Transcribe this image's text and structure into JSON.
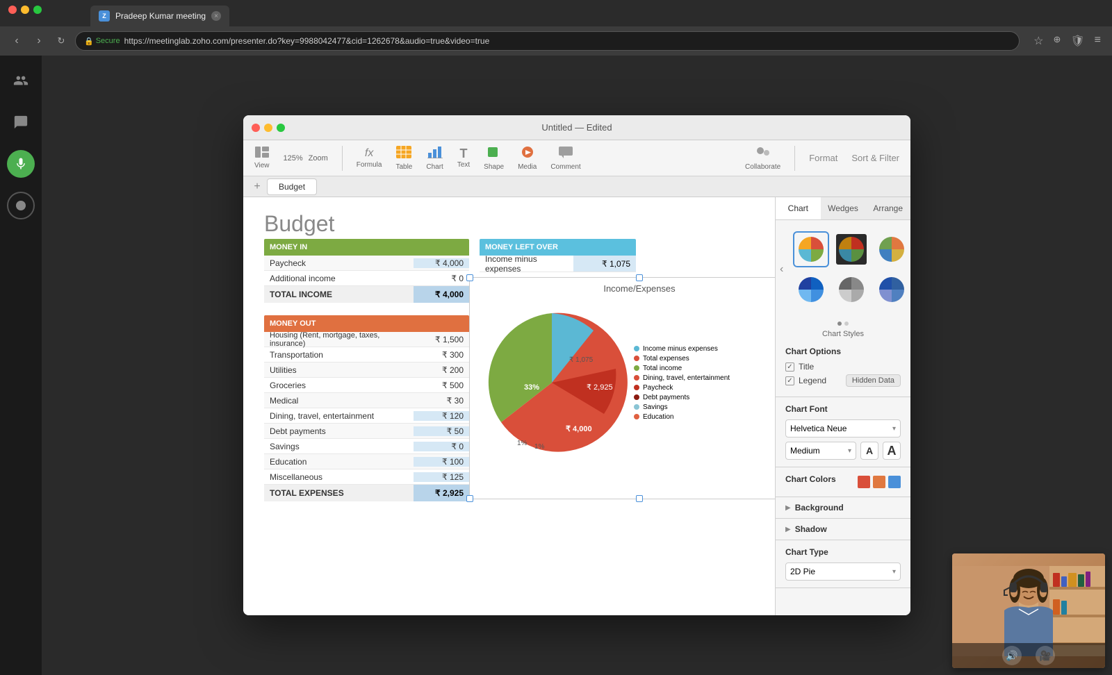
{
  "browser": {
    "tab_title": "Pradeep Kumar meeting",
    "url": "https://meetinglab.zoho.com/presenter.do?key=9988042477&cid=1262678&audio=true&video=true",
    "secure_text": "Secure"
  },
  "app": {
    "title": "Untitled — Edited",
    "sheet_tab": "Budget",
    "toolbar": {
      "view_label": "View",
      "zoom_value": "125%",
      "zoom_label": "Zoom",
      "formula_label": "Formula",
      "table_label": "Table",
      "chart_label": "Chart",
      "text_label": "Text",
      "shape_label": "Shape",
      "media_label": "Media",
      "comment_label": "Comment",
      "collaborate_label": "Collaborate",
      "format_label": "Format",
      "sort_filter_label": "Sort & Filter"
    }
  },
  "budget": {
    "page_title": "Budget",
    "money_in": {
      "header": "MONEY IN",
      "rows": [
        {
          "label": "Paycheck",
          "value": "₹ 4,000"
        },
        {
          "label": "Additional income",
          "value": "₹ 0"
        }
      ],
      "total_label": "TOTAL INCOME",
      "total_value": "₹ 4,000"
    },
    "money_left": {
      "header": "MONEY LEFT OVER",
      "label": "Income minus expenses",
      "value": "₹ 1,075"
    },
    "money_out": {
      "header": "MONEY OUT",
      "rows": [
        {
          "label": "Housing (Rent, mortgage, taxes, insurance)",
          "value": "₹ 1,500"
        },
        {
          "label": "Transportation",
          "value": "₹ 300"
        },
        {
          "label": "Utilities",
          "value": "₹ 200"
        },
        {
          "label": "Groceries",
          "value": "₹ 500"
        },
        {
          "label": "Medical",
          "value": "₹ 30"
        },
        {
          "label": "Dining, travel, entertainment",
          "value": "₹ 120"
        },
        {
          "label": "Debt payments",
          "value": "₹ 50"
        },
        {
          "label": "Savings",
          "value": "₹ 0"
        },
        {
          "label": "Education",
          "value": "₹ 100"
        },
        {
          "label": "Miscellaneous",
          "value": "₹ 125"
        }
      ],
      "total_label": "TOTAL EXPENSES",
      "total_value": "₹ 2,925"
    }
  },
  "chart": {
    "title": "Income/Expenses",
    "segments": [
      {
        "label": "Income minus expenses",
        "value": "₹ 1,075",
        "color": "#5bb8d4",
        "percent": "1%"
      },
      {
        "label": "Total expenses",
        "value": "₹ 2,925",
        "color": "#d94f3a",
        "percent": "33%"
      },
      {
        "label": "Total income",
        "value": "₹ 4,000",
        "color": "#7daa42",
        "percent": ""
      },
      {
        "label": "Dining, travel, entertainment",
        "value": "",
        "color": "#d94f3a",
        "percent": ""
      },
      {
        "label": "Paycheck",
        "value": "",
        "color": "#c03020",
        "percent": ""
      },
      {
        "label": "Debt payments",
        "value": "",
        "color": "#8b1a10",
        "percent": ""
      },
      {
        "label": "Savings",
        "value": "",
        "color": "#8ac4d4",
        "percent": ""
      },
      {
        "label": "Education",
        "value": "",
        "color": "#e06040",
        "percent": "1%"
      }
    ]
  },
  "right_panel": {
    "tabs": [
      "Chart",
      "Wedges",
      "Arrange"
    ],
    "chart_styles_label": "Chart Styles",
    "chart_options": {
      "title": "Chart Options",
      "title_check": "Title",
      "legend_check": "Legend",
      "hidden_data_label": "Hidden Data"
    },
    "chart_font": {
      "title": "Chart Font",
      "font_name": "Helvetica Neue",
      "font_size": "Medium",
      "size_a_small": "A",
      "size_a_large": "A"
    },
    "chart_colors_title": "Chart Colors",
    "background_label": "Background",
    "shadow_label": "Shadow",
    "chart_type": {
      "title": "Chart Type",
      "value": "2D Pie"
    }
  },
  "video": {
    "audio_icon": "🔊",
    "video_icon": "🎥"
  }
}
